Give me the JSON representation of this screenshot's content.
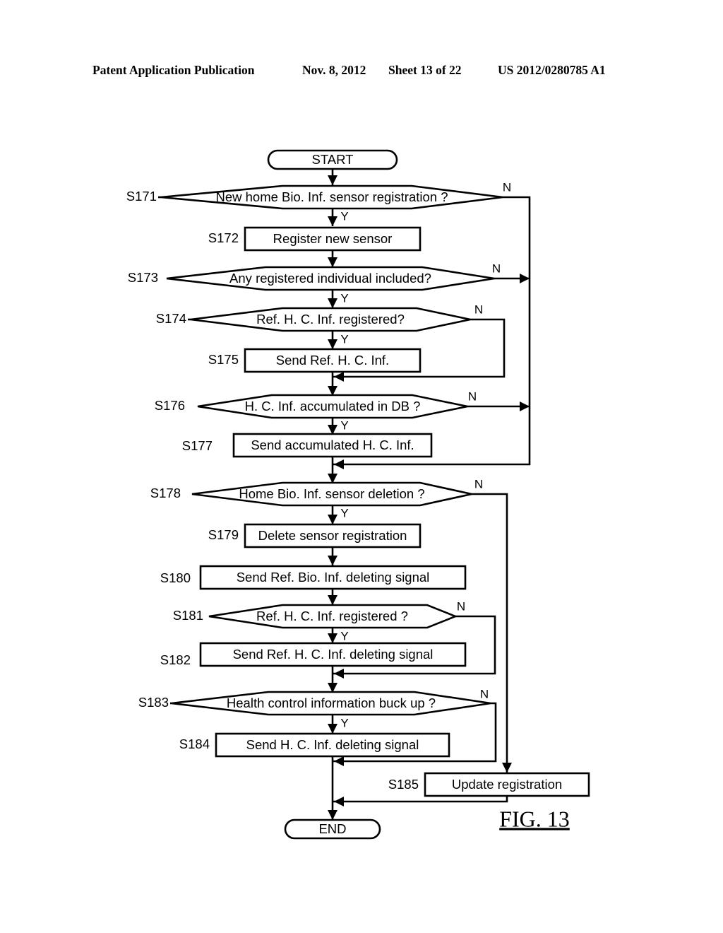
{
  "header": {
    "publication": "Patent Application Publication",
    "date": "Nov. 8, 2012",
    "sheet": "Sheet 13 of 22",
    "number": "US 2012/0280785 A1"
  },
  "figure_label": "FIG. 13",
  "flowchart": {
    "start": "START",
    "end": "END",
    "yes_label": "Y",
    "no_label": "N",
    "steps": [
      {
        "id": "S171",
        "type": "decision",
        "text": "New home Bio. Inf. sensor registration ?"
      },
      {
        "id": "S172",
        "type": "process",
        "text": "Register new sensor"
      },
      {
        "id": "S173",
        "type": "decision",
        "text": "Any registered individual included?"
      },
      {
        "id": "S174",
        "type": "decision",
        "text": "Ref. H. C. Inf. registered?"
      },
      {
        "id": "S175",
        "type": "process",
        "text": "Send Ref. H. C. Inf."
      },
      {
        "id": "S176",
        "type": "decision",
        "text": "H. C. Inf. accumulated in DB ?"
      },
      {
        "id": "S177",
        "type": "process",
        "text": "Send accumulated H. C. Inf."
      },
      {
        "id": "S178",
        "type": "decision",
        "text": "Home Bio. Inf. sensor deletion  ?"
      },
      {
        "id": "S179",
        "type": "process",
        "text": "Delete sensor registration"
      },
      {
        "id": "S180",
        "type": "process",
        "text": "Send Ref. Bio. Inf. deleting signal"
      },
      {
        "id": "S181",
        "type": "decision",
        "text": "Ref. H. C. Inf. registered ?"
      },
      {
        "id": "S182",
        "type": "process",
        "text": "Send Ref. H. C. Inf. deleting signal"
      },
      {
        "id": "S183",
        "type": "decision",
        "text": "Health control information buck up ?"
      },
      {
        "id": "S184",
        "type": "process",
        "text": "Send H. C. Inf. deleting signal"
      },
      {
        "id": "S185",
        "type": "process",
        "text": "Update registration"
      }
    ]
  }
}
